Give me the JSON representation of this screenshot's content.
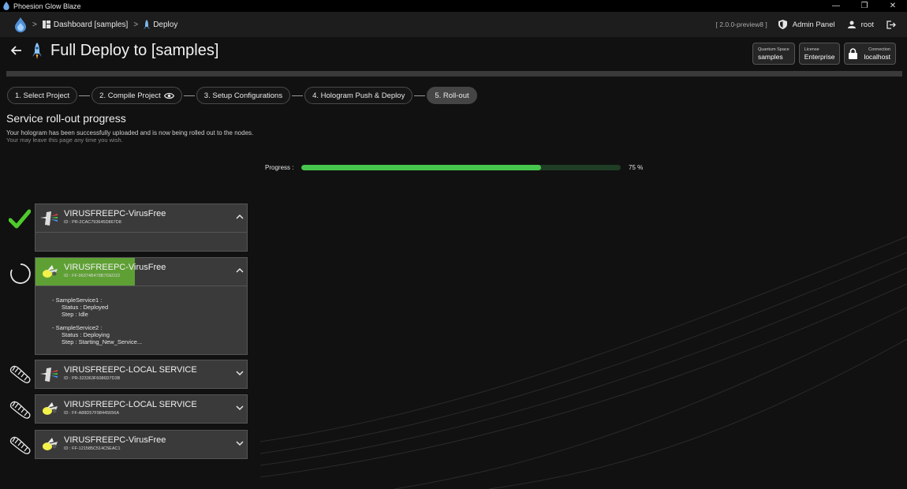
{
  "window": {
    "title": "Phoesion Glow Blaze"
  },
  "nav": {
    "breadcrumbs": [
      "Dashboard [samples]",
      "Deploy"
    ],
    "separator": ">",
    "version": "[ 2.0.0-preview8 ]",
    "admin_label": "Admin Panel",
    "user_label": "root"
  },
  "header": {
    "title": "Full Deploy to [samples]",
    "chips": {
      "space_label": "Quantum Space",
      "space_value": "samples",
      "license_label": "License",
      "license_value": "Enterprise",
      "conn_label": "Connection",
      "conn_value": "localhost"
    }
  },
  "steps": [
    "1. Select Project",
    "2. Compile Project",
    "3. Setup Configurations",
    "4. Hologram Push & Deploy",
    "5. Roll-out"
  ],
  "section": {
    "title": "Service roll-out progress",
    "desc1": "Your hologram has been successfully uploaded and is now being rolled out to the nodes.",
    "desc2": "Your may leave this page any time you wish."
  },
  "progress": {
    "label": "Progress :",
    "value": 0.75,
    "text": "75 %"
  },
  "colors": {
    "accent_green": "#47c64d",
    "highlight_green": "#5fa035",
    "track": "#1f3d24"
  },
  "nodes": [
    {
      "name": "VIRUSFREEPC-VirusFree",
      "id": "ID : PR-2CAC793645D867D8",
      "status": "done",
      "icon": "hologram-prism-icon",
      "expanded": true
    },
    {
      "name": "VIRUSFREEPC-VirusFree",
      "id": "ID : FF-96374B478B7DED22",
      "status": "in-progress",
      "icon": "firefly-icon",
      "expanded": true,
      "services": [
        {
          "name": "- SampleService1 :",
          "status": "Status : Deployed",
          "step": "Step : Idle"
        },
        {
          "name": "- SampleService2 :",
          "status": "Status : Deploying",
          "step": "Step : Starting_New_Service..."
        }
      ]
    },
    {
      "name": "VIRUSFREEPC-LOCAL SERVICE",
      "id": "ID : PR-323363F6086D7D3B",
      "status": "pending",
      "icon": "hologram-prism-icon",
      "expanded": false
    },
    {
      "name": "VIRUSFREEPC-LOCAL SERVICE",
      "id": "ID : FF-A88D57F98445656A",
      "status": "pending",
      "icon": "firefly-icon",
      "expanded": false
    },
    {
      "name": "VIRUSFREEPC-VirusFree",
      "id": "ID : FF-121585C514C5EAC1",
      "status": "pending",
      "icon": "firefly-icon",
      "expanded": false
    }
  ]
}
